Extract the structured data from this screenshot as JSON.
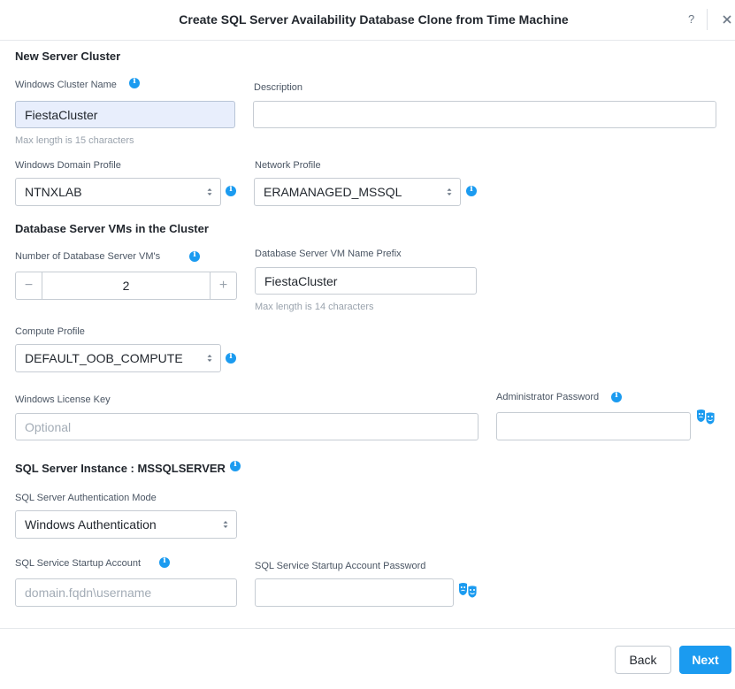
{
  "dialog": {
    "title": "Create SQL Server Availability Database Clone from Time Machine",
    "help_label": "?"
  },
  "new_server_cluster": {
    "section_title": "New Server Cluster",
    "cluster_name_label": "Windows Cluster Name",
    "cluster_name_value": "FiestaCluster",
    "cluster_name_hint": "Max length is 15 characters",
    "description_label": "Description",
    "description_value": "",
    "domain_profile_label": "Windows Domain Profile",
    "domain_profile_value": "NTNXLAB",
    "network_profile_label": "Network Profile",
    "network_profile_value": "ERAMANAGED_MSSQL"
  },
  "db_server_vms": {
    "section_title": "Database Server VMs in the Cluster",
    "vm_count_label": "Number of Database Server VM's",
    "vm_count_value": "2",
    "decrement_label": "−",
    "increment_label": "+",
    "vm_prefix_label": "Database Server VM Name Prefix",
    "vm_prefix_value": "FiestaCluster",
    "vm_prefix_hint": "Max length is 14 characters",
    "compute_profile_label": "Compute Profile",
    "compute_profile_value": "DEFAULT_OOB_COMPUTE",
    "license_key_label": "Windows License Key",
    "license_key_placeholder": "Optional",
    "admin_password_label": "Administrator Password"
  },
  "sql_instance": {
    "section_title": "SQL Server Instance : MSSQLSERVER",
    "auth_mode_label": "SQL Server Authentication Mode",
    "auth_mode_value": "Windows Authentication",
    "startup_account_label": "SQL Service Startup Account",
    "startup_account_placeholder": "domain.fqdn\\username",
    "startup_password_label": "SQL Service Startup Account Password"
  },
  "footer": {
    "back_label": "Back",
    "next_label": "Next"
  },
  "colors": {
    "accent": "#1b9bf0",
    "cluster_name_bg": "#e8eefc"
  },
  "icons": [
    "help-icon",
    "close-icon",
    "info-icon",
    "select-arrows-icon",
    "show-password-icon"
  ]
}
